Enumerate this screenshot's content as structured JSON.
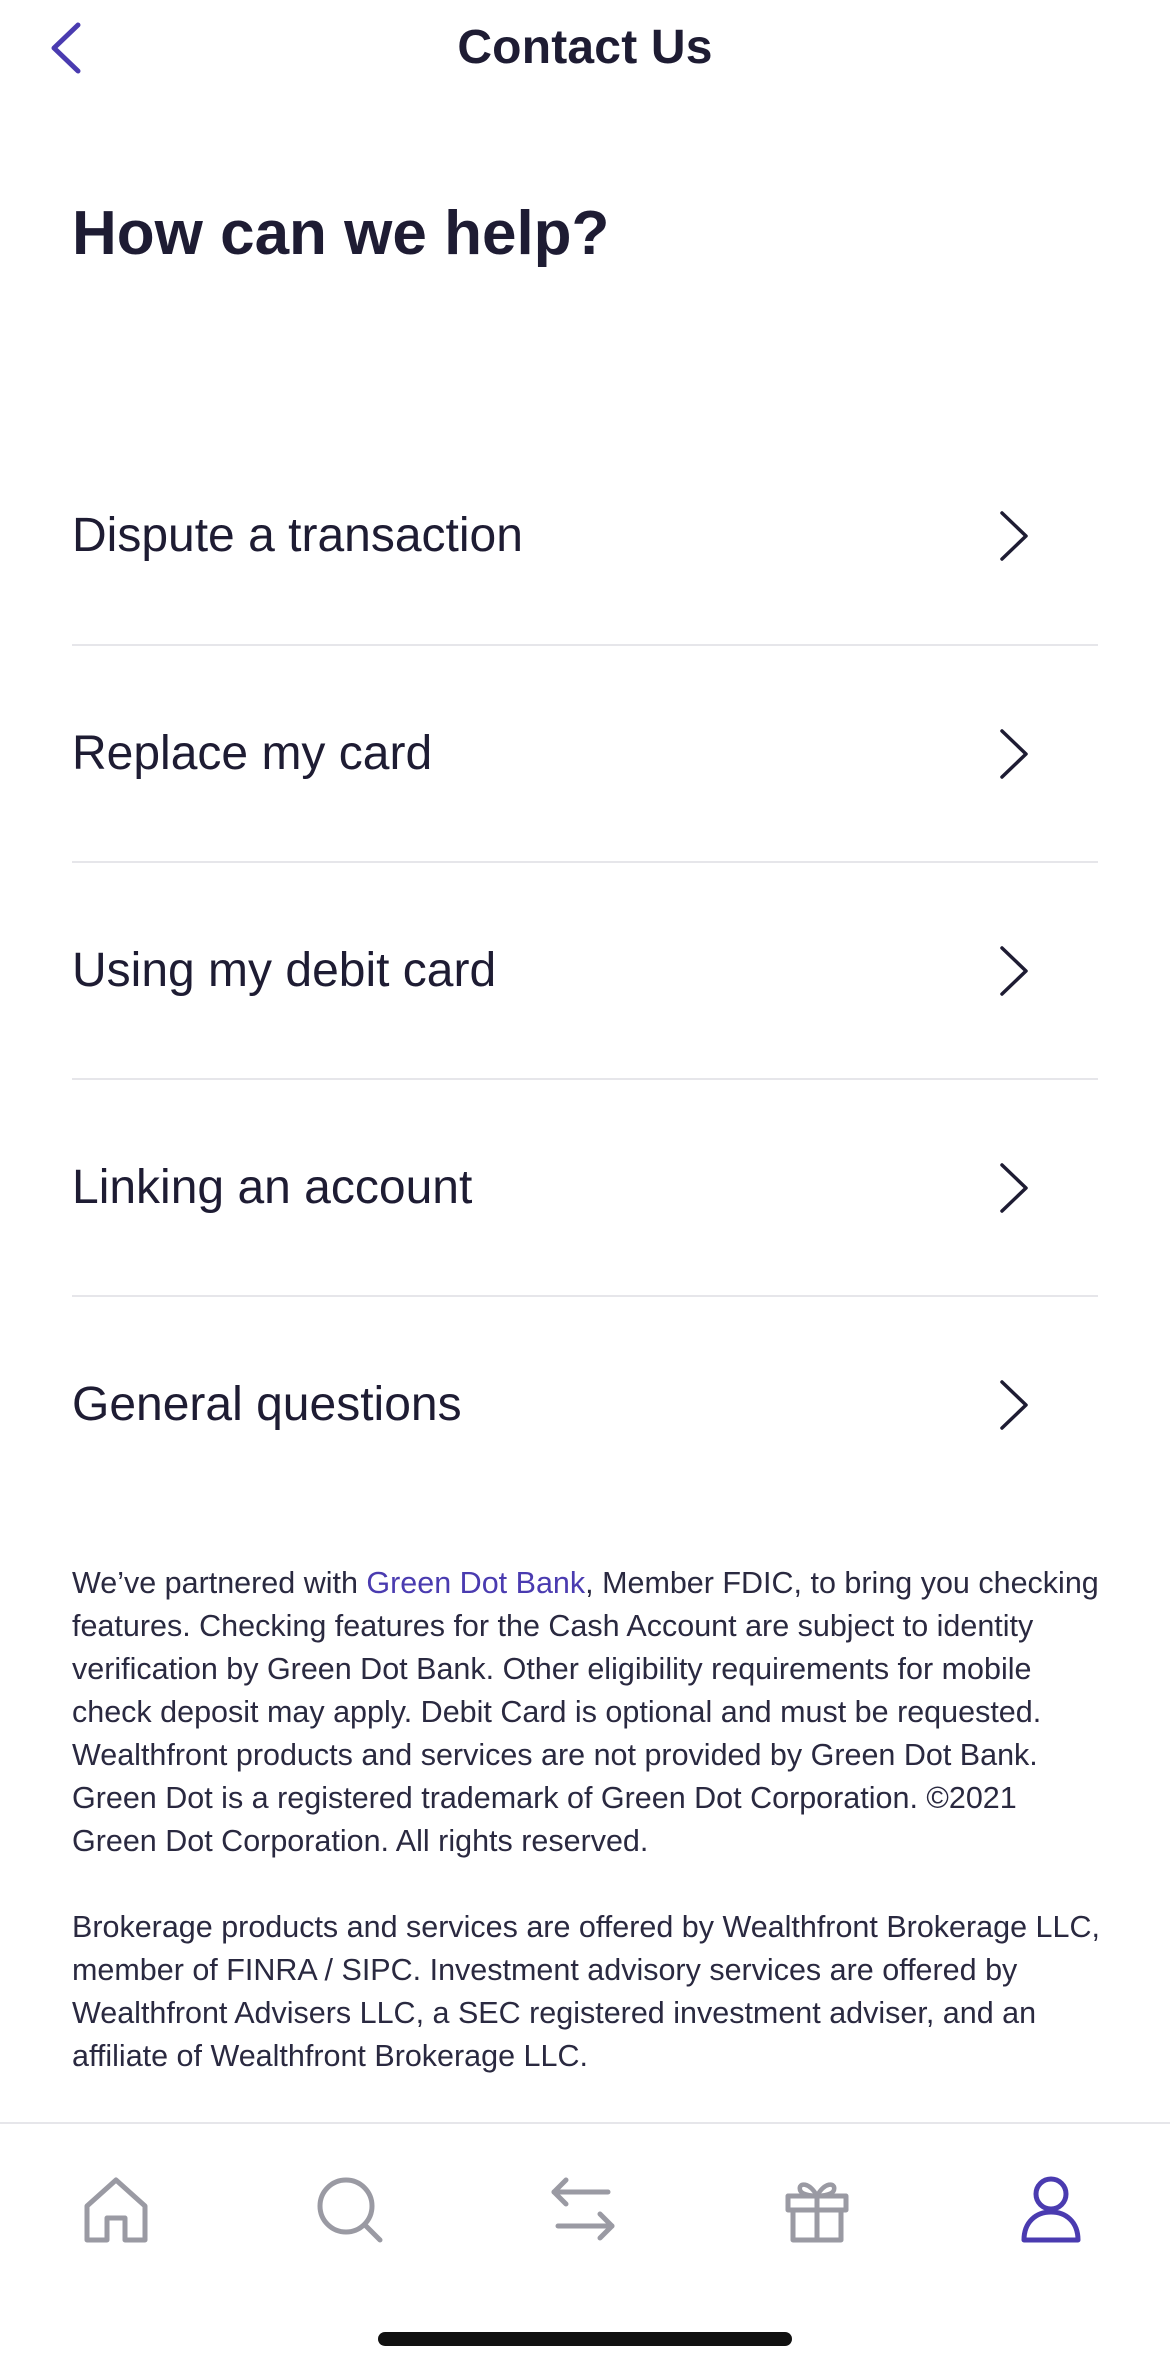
{
  "header": {
    "back_icon": "chevron-left-icon",
    "title": "Contact Us"
  },
  "heading": "How can we help?",
  "help_items": [
    {
      "label": "Dispute a transaction",
      "icon": "chevron-right-icon"
    },
    {
      "label": "Replace my card",
      "icon": "chevron-right-icon"
    },
    {
      "label": "Using my debit card",
      "icon": "chevron-right-icon"
    },
    {
      "label": "Linking an account",
      "icon": "chevron-right-icon"
    },
    {
      "label": "General questions",
      "icon": "chevron-right-icon"
    }
  ],
  "disclaimer": {
    "p1_before": "We’ve partnered with ",
    "p1_link": "Green Dot Bank",
    "p1_after": ", Member FDIC, to bring you checking features. Checking features for the Cash Account are subject to identity verification by Green Dot Bank. Other eligibility requirements for mobile check deposit may apply. Debit Card is optional and must be requested. Wealthfront products and services are not provided by Green Dot Bank. Green Dot is a registered trademark of Green Dot Corporation. ©2021 Green Dot Corporation. All rights reserved.",
    "p2": "Brokerage products and services are offered by Wealthfront Brokerage LLC, member of FINRA / SIPC. Investment advisory services are offered by Wealthfront Advisers LLC, a SEC registered investment adviser, and an affiliate of Wealthfront Brokerage LLC."
  },
  "tab_bar": {
    "tabs": [
      {
        "icon": "home-icon",
        "active": false
      },
      {
        "icon": "search-icon",
        "active": false
      },
      {
        "icon": "transfer-arrows-icon",
        "active": false
      },
      {
        "icon": "gift-icon",
        "active": false
      },
      {
        "icon": "profile-icon",
        "active": true
      }
    ]
  },
  "colors": {
    "accent": "#4a3bb0",
    "text": "#1e1c33",
    "inactive_icon": "#9a9aa3",
    "divider": "#e6e6ea"
  }
}
